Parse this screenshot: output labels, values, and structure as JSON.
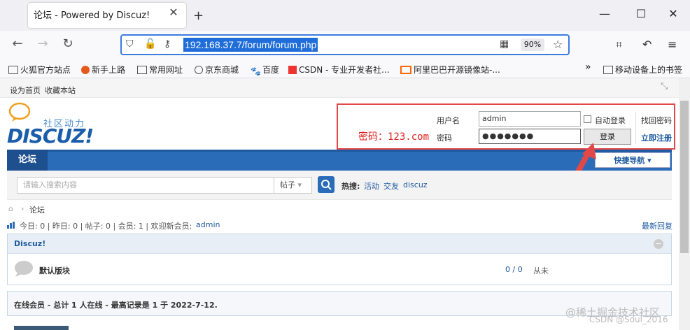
{
  "browser": {
    "tab_title": "论坛 - Powered by Discuz!",
    "url": "192.168.37.7/forum/forum.php",
    "zoom": "90%",
    "bookmarks": [
      "火狐官方站点",
      "新手上路",
      "常用网址",
      "京东商城",
      "百度",
      "CSDN - 专业开发者社...",
      "阿里巴巴开源镜像站-...",
      "移动设备上的书签"
    ]
  },
  "top_links": [
    "设为首页",
    "收藏本站"
  ],
  "logo": {
    "text": "DISCUZ!",
    "sub": "社区动力"
  },
  "login": {
    "username_label": "用户名",
    "username_value": "admin",
    "auto_login": "自动登录",
    "find_password": "找回密码",
    "password_label": "密码",
    "password_value": "●●●●●●●",
    "login_button": "登录",
    "register": "立即注册",
    "note": "密码：123.com"
  },
  "nav": {
    "home": "论坛",
    "quick_nav": "快捷导航"
  },
  "search": {
    "placeholder": "请输入搜索内容",
    "type": "帖子",
    "hot_label": "热搜:",
    "hot": [
      "活动",
      "交友",
      "discuz"
    ]
  },
  "breadcrumb": {
    "current": "论坛"
  },
  "stats": {
    "text": "今日: 0 | 昨日: 0 | 帖子: 0 | 会员: 1 | 欢迎新会员:",
    "member": "admin",
    "latest": "最新回复"
  },
  "category": {
    "title": "Discuz!",
    "forum_name": "默认版块",
    "counts": "0 / 0",
    "last": "从未"
  },
  "online": {
    "text": "在线会员 - 总计 1 人在线 - 最高记录是 1 于 2022-7-12."
  },
  "watermark": {
    "line1": "@稀土掘金技术社区",
    "line2": "CSDN @Soul_2016"
  },
  "colors": {
    "accent": "#2b6cb8",
    "red": "#e24848",
    "url_highlight": "#1e6dd8"
  }
}
